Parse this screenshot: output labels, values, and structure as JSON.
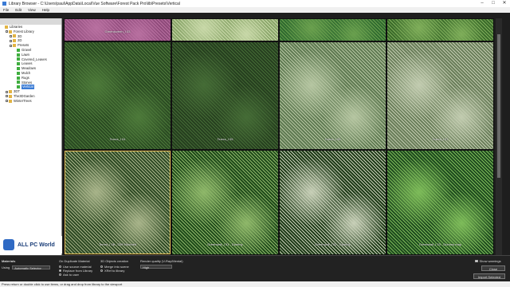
{
  "window": {
    "title": "Library Browser - C:\\Users\\paul\\AppData\\Local\\Vue Software\\Forest Pack Pro\\lib\\Presets\\Vertical"
  },
  "menu": [
    "File",
    "Edit",
    "View",
    "Help"
  ],
  "sidebar": {
    "items": [
      {
        "label": "Libraries",
        "indent": 0,
        "kind": "root"
      },
      {
        "label": "Forest Library",
        "indent": 1,
        "kind": "folder"
      },
      {
        "label": "3D",
        "indent": 2,
        "kind": "folder"
      },
      {
        "label": "2D",
        "indent": 2,
        "kind": "folder"
      },
      {
        "label": "Presets",
        "indent": 2,
        "kind": "folder"
      },
      {
        "label": "Gravel",
        "indent": 3,
        "kind": "green"
      },
      {
        "label": "Lawn",
        "indent": 3,
        "kind": "green"
      },
      {
        "label": "Covered_Leaves",
        "indent": 3,
        "kind": "green"
      },
      {
        "label": "Leaves",
        "indent": 3,
        "kind": "green"
      },
      {
        "label": "Meadows",
        "indent": 3,
        "kind": "green"
      },
      {
        "label": "Mulch",
        "indent": 3,
        "kind": "green"
      },
      {
        "label": "Rugs",
        "indent": 3,
        "kind": "green"
      },
      {
        "label": "Stones",
        "indent": 3,
        "kind": "green"
      },
      {
        "label": "Vertical",
        "indent": 3,
        "kind": "green",
        "selected": true
      },
      {
        "label": "3DT",
        "indent": 1,
        "kind": "folder"
      },
      {
        "label": "The3DGarden",
        "indent": 1,
        "kind": "folder"
      },
      {
        "label": "WinterTrees",
        "indent": 1,
        "kind": "folder"
      }
    ]
  },
  "tiles": [
    {
      "label": "Greenscreen_I 03",
      "color_a": "#8e4a7a",
      "color_b": "#b870a0"
    },
    {
      "label": "",
      "color_a": "#8aa66a",
      "color_b": "#c8d8a8"
    },
    {
      "label": "",
      "color_a": "#2f6a2f",
      "color_b": "#6aa04e"
    },
    {
      "label": "",
      "color_a": "#3a6a2a",
      "color_b": "#7fae5a"
    },
    {
      "label": "Terres_I 04",
      "color_a": "#2a4a22",
      "color_b": "#4d7a3a"
    },
    {
      "label": "Terres_I 05",
      "color_a": "#263f1f",
      "color_b": "#456c36"
    },
    {
      "label": "Terres_I 06",
      "color_a": "#5f7a52",
      "color_b": "#b6c6a2"
    },
    {
      "label": "Terres_I 07",
      "color_a": "#6a7e5a",
      "color_b": "#c2ccb0"
    },
    {
      "label": "Terres_I 08 - Cliff Mounted",
      "color_a": "#2e4a24",
      "color_b": "#a8b48a"
    },
    {
      "label": "Greenwall_I 01 - Dummy",
      "color_a": "#1f4a1a",
      "color_b": "#8fb86a"
    },
    {
      "label": "Greenwall_I 02 - Dummy",
      "color_a": "#1e3a18",
      "color_b": "#c8d0b8"
    },
    {
      "label": "Greenwall_I 03 - Dummy map",
      "color_a": "#1e4a1e",
      "color_b": "#7ebc5a"
    }
  ],
  "bottom": {
    "materials_label": "Materials",
    "using_label": "Using",
    "using_value": "Automatic Selector",
    "duplicate_label": "On Duplicate Material",
    "dup_options": [
      {
        "label": "Use source material",
        "on": false
      },
      {
        "label": "Replace from Library",
        "on": true
      },
      {
        "label": "Ask to user",
        "on": false
      }
    ],
    "objects_label": "3D Objects creation",
    "obj_options": [
      {
        "label": "Merge into scene",
        "on": false
      },
      {
        "label": "XRef to library",
        "on": false
      }
    ],
    "render_label": "Render quality (V-Ray/Mental)",
    "render_value": "High",
    "warnings_label": "Show warnings",
    "close_label": "Close",
    "import_label": "Import Selected"
  },
  "status": "Press return or double click to use items, or drag and drop from library to the viewport",
  "watermark": "ALL PC World"
}
